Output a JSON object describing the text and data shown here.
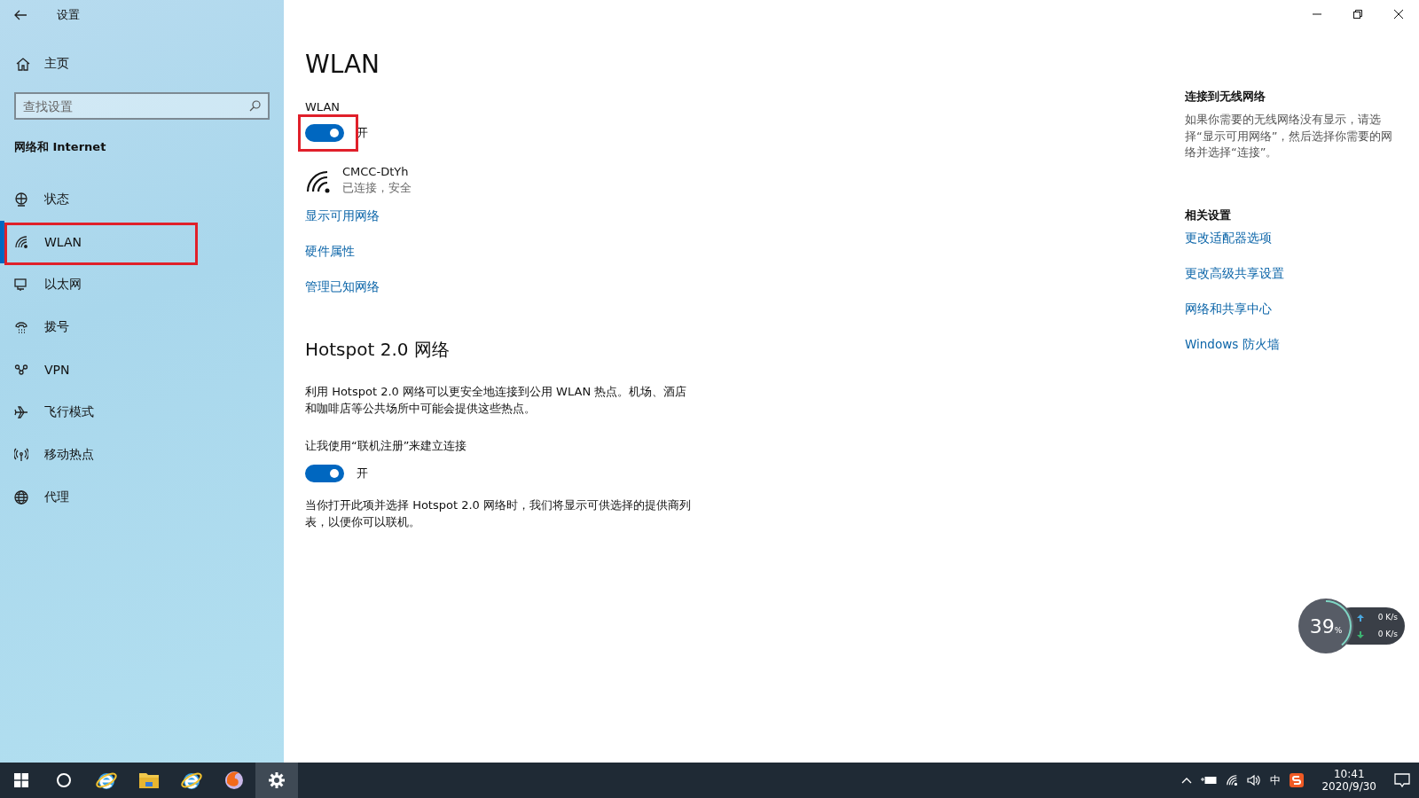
{
  "window": {
    "title": "设置"
  },
  "sidebar": {
    "home": "主页",
    "search": {
      "placeholder": "查找设置"
    },
    "section": "网络和 Internet",
    "items": [
      {
        "label": "状态",
        "kind": "status",
        "selected": false,
        "highlighted": false
      },
      {
        "label": "WLAN",
        "kind": "wifi",
        "selected": true,
        "highlighted": true
      },
      {
        "label": "以太网",
        "kind": "ethernet",
        "selected": false,
        "highlighted": false
      },
      {
        "label": "拨号",
        "kind": "dialup",
        "selected": false,
        "highlighted": false
      },
      {
        "label": "VPN",
        "kind": "vpn",
        "selected": false,
        "highlighted": false
      },
      {
        "label": "飞行模式",
        "kind": "plane",
        "selected": false,
        "highlighted": false
      },
      {
        "label": "移动热点",
        "kind": "hotspot",
        "selected": false,
        "highlighted": false
      },
      {
        "label": "代理",
        "kind": "globe",
        "selected": false,
        "highlighted": false
      }
    ]
  },
  "main": {
    "title": "WLAN",
    "wlan_toggle": {
      "label": "WLAN",
      "on": true,
      "state_text": "开",
      "highlighted": true
    },
    "network": {
      "name": "CMCC-DtYh",
      "status": "已连接，安全"
    },
    "links": [
      "显示可用网络",
      "硬件属性",
      "管理已知网络"
    ],
    "hotspot": {
      "heading": "Hotspot 2.0 网络",
      "description": "利用 Hotspot 2.0 网络可以更安全地连接到公用 WLAN 热点。机场、酒店和咖啡店等公共场所中可能会提供这些热点。",
      "toggle": {
        "label": "让我使用“联机注册”来建立连接",
        "on": true,
        "state_text": "开"
      },
      "note": "当你打开此项并选择 Hotspot 2.0 网络时，我们将显示可供选择的提供商列表，以便你可以联机。"
    }
  },
  "aside": {
    "connect_heading": "连接到无线网络",
    "connect_text": "如果你需要的无线网络没有显示，请选择“显示可用网络”，然后选择你需要的网络并选择“连接”。",
    "related_heading": "相关设置",
    "related_links": [
      "更改适配器选项",
      "更改高级共享设置",
      "网络和共享中心",
      "Windows 防火墙"
    ]
  },
  "speed_widget": {
    "percent": "39",
    "percent_unit": "%",
    "upload": "0",
    "upload_unit": "K/s",
    "download": "0",
    "download_unit": "K/s"
  },
  "taskbar": {
    "apps": [
      {
        "kind": "search",
        "selected": false
      },
      {
        "kind": "ie",
        "selected": false
      },
      {
        "kind": "folder",
        "selected": false
      },
      {
        "kind": "ie",
        "selected": false
      },
      {
        "kind": "fox",
        "selected": false
      },
      {
        "kind": "gear",
        "selected": true
      }
    ],
    "ime": "中",
    "time": "10:41",
    "date": "2020/9/30"
  }
}
